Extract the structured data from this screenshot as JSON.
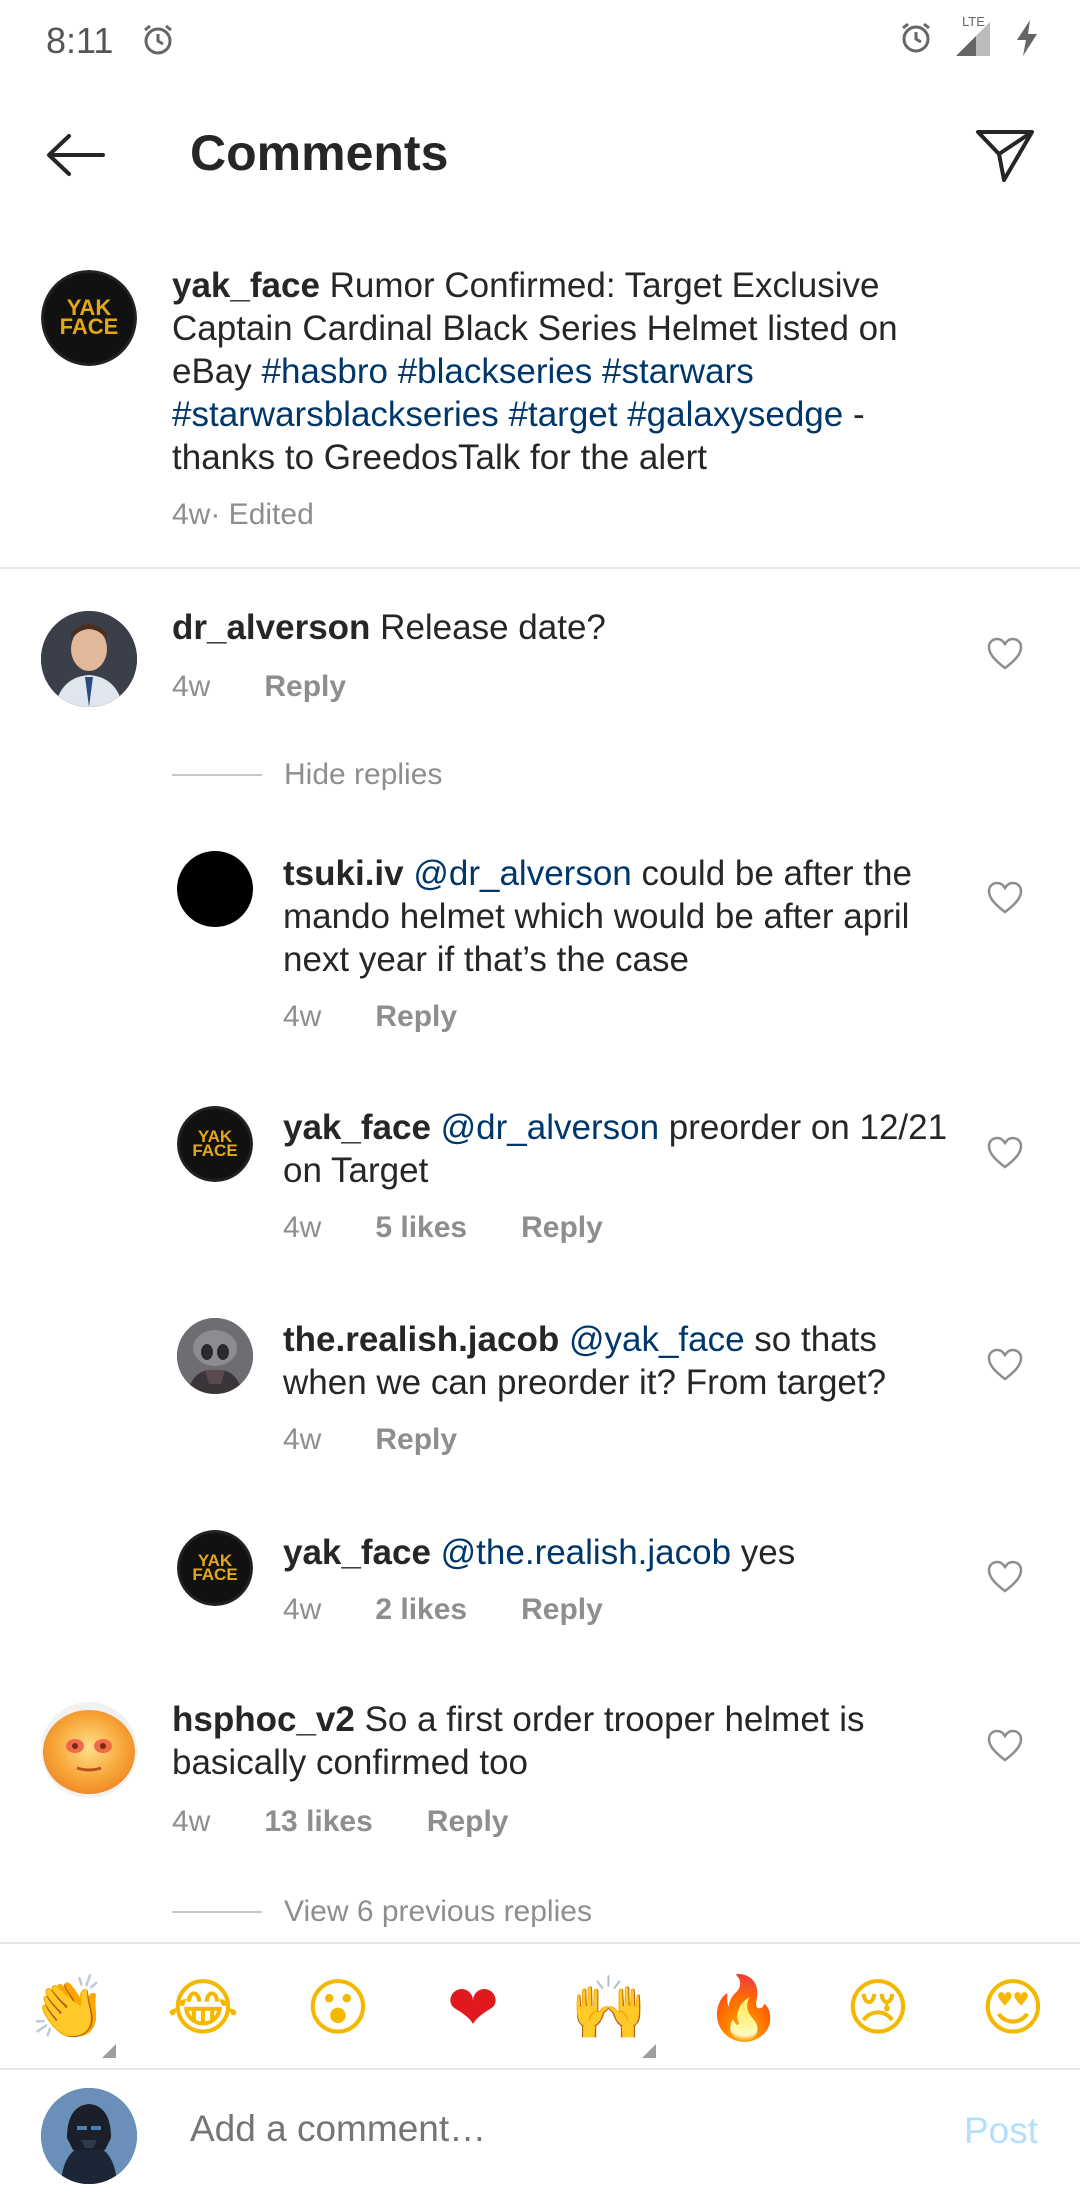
{
  "status_bar": {
    "time": "8:11",
    "network": "LTE",
    "icons": [
      "alarm-icon",
      "alarm-icon",
      "signal-icon",
      "charging-icon"
    ]
  },
  "header": {
    "title": "Comments",
    "back_icon": "arrow-left-icon",
    "share_icon": "paper-plane-icon"
  },
  "caption": {
    "username": "yak_face",
    "text_1": " Rumor Confirmed: Target Exclusive Captain Cardinal Black Series Helmet listed on eBay  ",
    "hashtags_1": [
      "#hasbro",
      "#blackseries",
      "#starwars"
    ],
    "hashtags_2": [
      "#starwarsblackseries",
      "#target",
      "#galaxysedge"
    ],
    "text_2": " - thanks to GreedosTalk for the alert",
    "time": "4w",
    "edited": " · Edited",
    "avatar_text": "YAK FACE"
  },
  "comments": [
    {
      "username": "dr_alverson",
      "text": " Release date?",
      "time": "4w",
      "reply_label": "Reply"
    }
  ],
  "hide_replies": "Hide replies",
  "replies": [
    {
      "username": "tsuki.iv",
      "mention": "@dr_alverson",
      "text": " could be after the mando helmet which would be after april next year if that’s the case",
      "time": "4w",
      "likes": "",
      "reply_label": "Reply"
    },
    {
      "username": "yak_face",
      "mention": "@dr_alverson",
      "text": " preorder on 12/21 on Target",
      "time": "4w",
      "likes": "5 likes",
      "reply_label": "Reply"
    },
    {
      "username": "the.realish.jacob",
      "mention": "@yak_face",
      "text": " so thats when we can preorder it? From target?",
      "time": "4w",
      "likes": "",
      "reply_label": "Reply"
    },
    {
      "username": "yak_face",
      "mention": "@the.realish.jacob",
      "text": " yes",
      "time": "4w",
      "likes": "2 likes",
      "reply_label": "Reply"
    }
  ],
  "comment_2": {
    "username": "hsphoc_v2",
    "text": " So a first order trooper helmet is basically confirmed too",
    "time": "4w",
    "likes": "13 likes",
    "reply_label": "Reply"
  },
  "view_previous": "View 6 previous replies",
  "emojis": [
    "👏",
    "😂",
    "😮",
    "❤",
    "🙌",
    "🔥",
    "😢",
    "😍"
  ],
  "compose": {
    "placeholder": "Add a comment…",
    "post_label": "Post"
  }
}
